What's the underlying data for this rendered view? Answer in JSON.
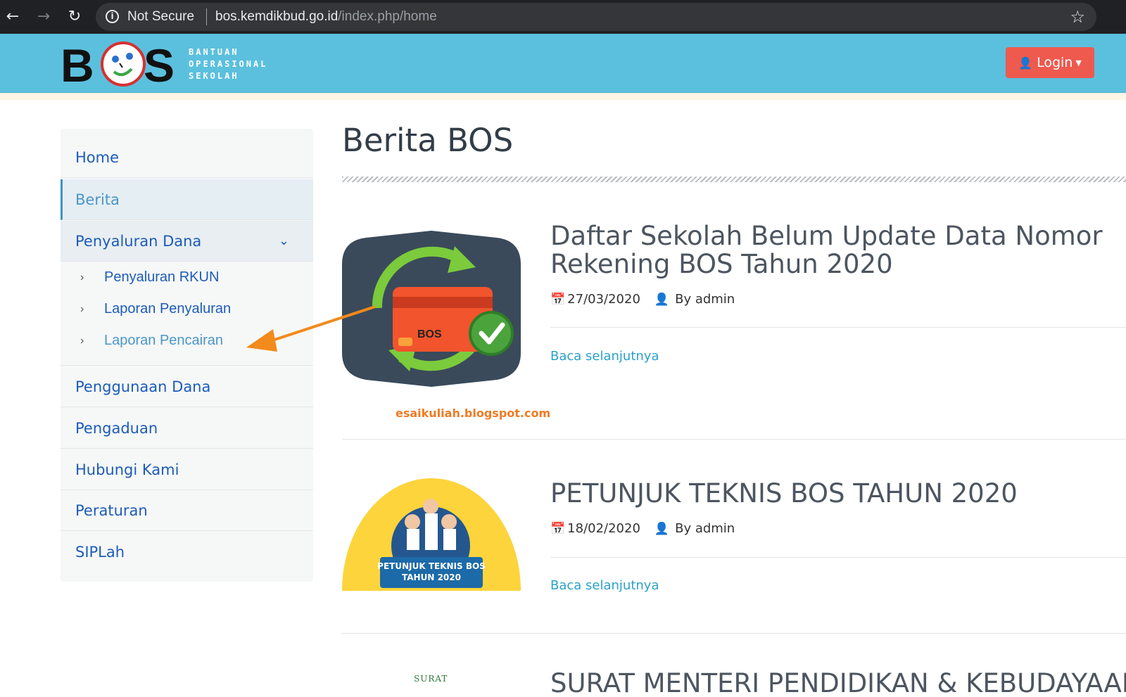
{
  "browser": {
    "security_label": "Not Secure",
    "url_host": "bos.kemdikbud.go.id",
    "url_path": "/index.php/home"
  },
  "header": {
    "logo_word": "BOS",
    "logo_sub": [
      "BANTUAN",
      "OPERASIONAL",
      "SEKOLAH"
    ],
    "login_label": "Login",
    "colors": {
      "header_bg": "#5bc0de",
      "login_bg": "#ee5a4e"
    }
  },
  "sidebar": {
    "items": [
      {
        "label": "Home"
      },
      {
        "label": "Berita",
        "active": true
      },
      {
        "label": "Penyaluran Dana",
        "expanded": true,
        "children": [
          {
            "label": "Penyaluran RKUN"
          },
          {
            "label": "Laporan Penyaluran"
          },
          {
            "label": "Laporan Pencairan"
          }
        ]
      },
      {
        "label": "Penggunaan Dana"
      },
      {
        "label": "Pengaduan"
      },
      {
        "label": "Hubungi Kami"
      },
      {
        "label": "Peraturan"
      },
      {
        "label": "SIPLah"
      }
    ]
  },
  "main": {
    "title": "Berita BOS",
    "news": [
      {
        "title": "Daftar Sekolah Belum Update Data Nomor Rekening BOS Tahun 2020",
        "date": "27/03/2020",
        "author": "By admin",
        "read_more": "Baca selanjutnya",
        "thumb_text": "BOS",
        "watermark": "esaikuliah.blogspot.com"
      },
      {
        "title": "PETUNJUK TEKNIS BOS TAHUN 2020",
        "date": "18/02/2020",
        "author": "By admin",
        "read_more": "Baca selanjutnya",
        "thumb_lines": [
          "PETUNJUK TEKNIS BOS",
          "TAHUN 2020"
        ]
      },
      {
        "title": "SURAT MENTERI PENDIDIKAN & KEBUDAYAAN",
        "thumb_text": "SURAT"
      }
    ]
  },
  "annotation": {
    "arrow_color": "#f28a1c"
  }
}
